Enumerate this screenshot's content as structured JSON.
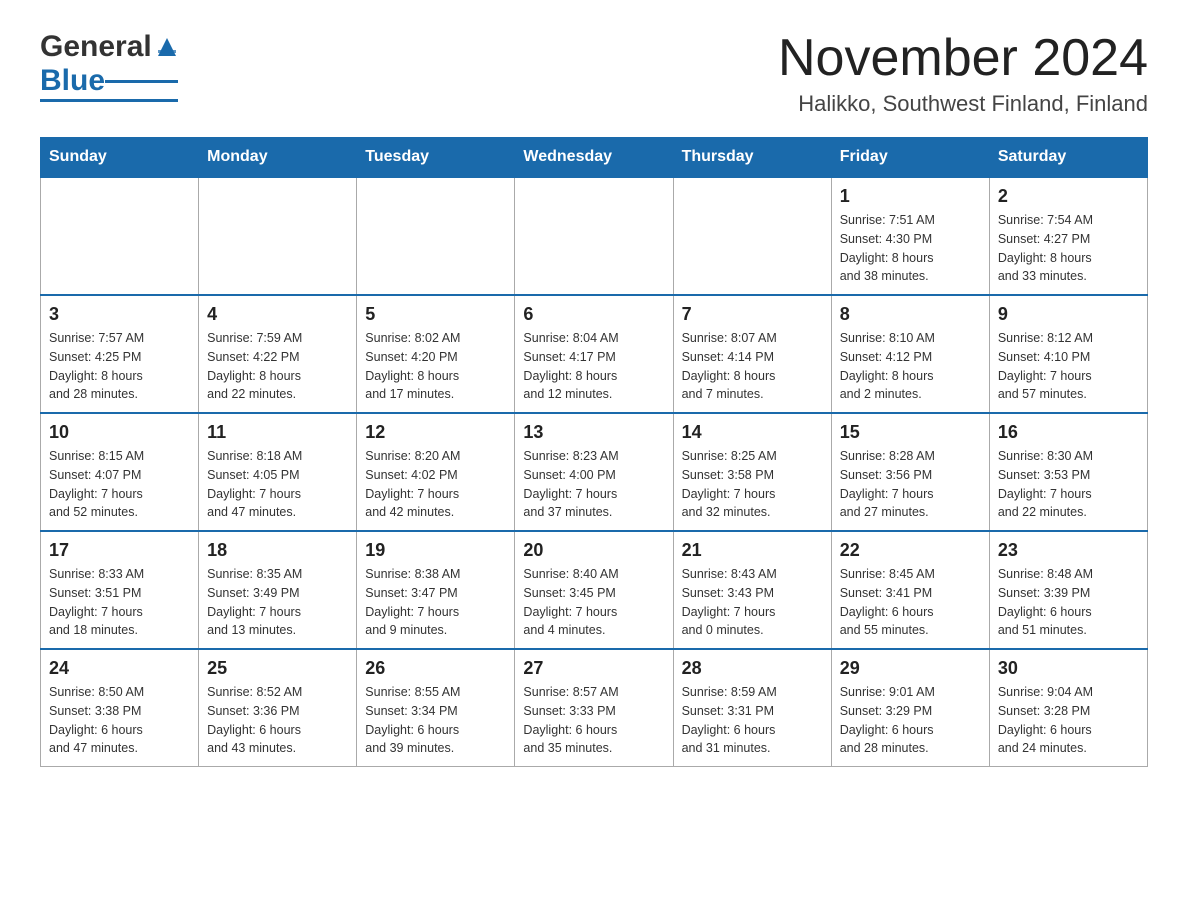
{
  "header": {
    "month_title": "November 2024",
    "location": "Halikko, Southwest Finland, Finland",
    "logo_general": "General",
    "logo_blue": "Blue"
  },
  "columns": [
    "Sunday",
    "Monday",
    "Tuesday",
    "Wednesday",
    "Thursday",
    "Friday",
    "Saturday"
  ],
  "weeks": [
    [
      {
        "day": "",
        "info": ""
      },
      {
        "day": "",
        "info": ""
      },
      {
        "day": "",
        "info": ""
      },
      {
        "day": "",
        "info": ""
      },
      {
        "day": "",
        "info": ""
      },
      {
        "day": "1",
        "info": "Sunrise: 7:51 AM\nSunset: 4:30 PM\nDaylight: 8 hours\nand 38 minutes."
      },
      {
        "day": "2",
        "info": "Sunrise: 7:54 AM\nSunset: 4:27 PM\nDaylight: 8 hours\nand 33 minutes."
      }
    ],
    [
      {
        "day": "3",
        "info": "Sunrise: 7:57 AM\nSunset: 4:25 PM\nDaylight: 8 hours\nand 28 minutes."
      },
      {
        "day": "4",
        "info": "Sunrise: 7:59 AM\nSunset: 4:22 PM\nDaylight: 8 hours\nand 22 minutes."
      },
      {
        "day": "5",
        "info": "Sunrise: 8:02 AM\nSunset: 4:20 PM\nDaylight: 8 hours\nand 17 minutes."
      },
      {
        "day": "6",
        "info": "Sunrise: 8:04 AM\nSunset: 4:17 PM\nDaylight: 8 hours\nand 12 minutes."
      },
      {
        "day": "7",
        "info": "Sunrise: 8:07 AM\nSunset: 4:14 PM\nDaylight: 8 hours\nand 7 minutes."
      },
      {
        "day": "8",
        "info": "Sunrise: 8:10 AM\nSunset: 4:12 PM\nDaylight: 8 hours\nand 2 minutes."
      },
      {
        "day": "9",
        "info": "Sunrise: 8:12 AM\nSunset: 4:10 PM\nDaylight: 7 hours\nand 57 minutes."
      }
    ],
    [
      {
        "day": "10",
        "info": "Sunrise: 8:15 AM\nSunset: 4:07 PM\nDaylight: 7 hours\nand 52 minutes."
      },
      {
        "day": "11",
        "info": "Sunrise: 8:18 AM\nSunset: 4:05 PM\nDaylight: 7 hours\nand 47 minutes."
      },
      {
        "day": "12",
        "info": "Sunrise: 8:20 AM\nSunset: 4:02 PM\nDaylight: 7 hours\nand 42 minutes."
      },
      {
        "day": "13",
        "info": "Sunrise: 8:23 AM\nSunset: 4:00 PM\nDaylight: 7 hours\nand 37 minutes."
      },
      {
        "day": "14",
        "info": "Sunrise: 8:25 AM\nSunset: 3:58 PM\nDaylight: 7 hours\nand 32 minutes."
      },
      {
        "day": "15",
        "info": "Sunrise: 8:28 AM\nSunset: 3:56 PM\nDaylight: 7 hours\nand 27 minutes."
      },
      {
        "day": "16",
        "info": "Sunrise: 8:30 AM\nSunset: 3:53 PM\nDaylight: 7 hours\nand 22 minutes."
      }
    ],
    [
      {
        "day": "17",
        "info": "Sunrise: 8:33 AM\nSunset: 3:51 PM\nDaylight: 7 hours\nand 18 minutes."
      },
      {
        "day": "18",
        "info": "Sunrise: 8:35 AM\nSunset: 3:49 PM\nDaylight: 7 hours\nand 13 minutes."
      },
      {
        "day": "19",
        "info": "Sunrise: 8:38 AM\nSunset: 3:47 PM\nDaylight: 7 hours\nand 9 minutes."
      },
      {
        "day": "20",
        "info": "Sunrise: 8:40 AM\nSunset: 3:45 PM\nDaylight: 7 hours\nand 4 minutes."
      },
      {
        "day": "21",
        "info": "Sunrise: 8:43 AM\nSunset: 3:43 PM\nDaylight: 7 hours\nand 0 minutes."
      },
      {
        "day": "22",
        "info": "Sunrise: 8:45 AM\nSunset: 3:41 PM\nDaylight: 6 hours\nand 55 minutes."
      },
      {
        "day": "23",
        "info": "Sunrise: 8:48 AM\nSunset: 3:39 PM\nDaylight: 6 hours\nand 51 minutes."
      }
    ],
    [
      {
        "day": "24",
        "info": "Sunrise: 8:50 AM\nSunset: 3:38 PM\nDaylight: 6 hours\nand 47 minutes."
      },
      {
        "day": "25",
        "info": "Sunrise: 8:52 AM\nSunset: 3:36 PM\nDaylight: 6 hours\nand 43 minutes."
      },
      {
        "day": "26",
        "info": "Sunrise: 8:55 AM\nSunset: 3:34 PM\nDaylight: 6 hours\nand 39 minutes."
      },
      {
        "day": "27",
        "info": "Sunrise: 8:57 AM\nSunset: 3:33 PM\nDaylight: 6 hours\nand 35 minutes."
      },
      {
        "day": "28",
        "info": "Sunrise: 8:59 AM\nSunset: 3:31 PM\nDaylight: 6 hours\nand 31 minutes."
      },
      {
        "day": "29",
        "info": "Sunrise: 9:01 AM\nSunset: 3:29 PM\nDaylight: 6 hours\nand 28 minutes."
      },
      {
        "day": "30",
        "info": "Sunrise: 9:04 AM\nSunset: 3:28 PM\nDaylight: 6 hours\nand 24 minutes."
      }
    ]
  ]
}
